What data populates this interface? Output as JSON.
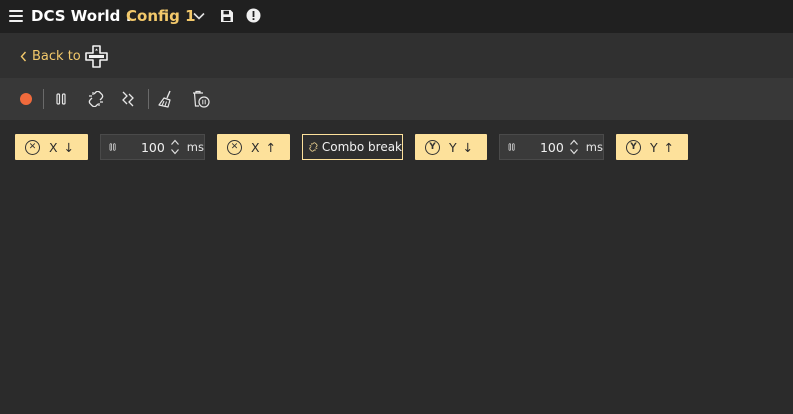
{
  "titlebar": {
    "app_name": "DCS World :",
    "config_name": "Config 1"
  },
  "nav": {
    "back_label": "Back to"
  },
  "sequence": [
    {
      "type": "key",
      "button": "X",
      "direction": "↓"
    },
    {
      "type": "delay",
      "value": "100",
      "unit": "ms"
    },
    {
      "type": "key",
      "button": "X",
      "direction": "↑"
    },
    {
      "type": "combo",
      "label": "Combo break"
    },
    {
      "type": "key",
      "button": "Y",
      "direction": "↓"
    },
    {
      "type": "delay",
      "value": "100",
      "unit": "ms"
    },
    {
      "type": "key",
      "button": "Y",
      "direction": "↑"
    }
  ],
  "colors": {
    "accent": "#f3c96b",
    "chip_bg": "#fde19b",
    "record": "#f06a3c",
    "background": "#2b2b2b"
  }
}
